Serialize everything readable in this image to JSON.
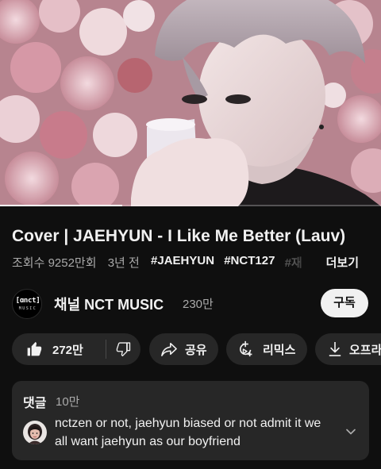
{
  "video": {
    "progress": 0.32
  },
  "title": "Cover | JAEHYUN - I Like Me Better (Lauv)",
  "meta": {
    "views": "조회수 9252만회",
    "age": "3년 전",
    "hashtags": [
      "#JAEHYUN",
      "#NCT127",
      "#재"
    ],
    "more_label": "더보기"
  },
  "channel": {
    "logo_text": "[ɑnct]",
    "logo_subtext": "MUSIC",
    "name": "채널 NCT MUSIC",
    "subscribers": "230만",
    "subscribe_label": "구독"
  },
  "actions": {
    "likes": "272만",
    "share_label": "공유",
    "remix_label": "리믹스",
    "offline_label": "오프라"
  },
  "comments": {
    "title": "댓글",
    "count": "10만",
    "top_comment": "nctzen or not, jaehyun biased or not admit it we all want jaehyun as our boyfriend"
  },
  "colors": {
    "background": "#0f0f0f",
    "pill": "#272727",
    "text": "#f1f1f1",
    "muted": "#aaaaaa",
    "subscribe_bg": "#f1f1f1"
  },
  "icons": [
    "thumbs-up-icon",
    "thumbs-down-icon",
    "share-icon",
    "remix-icon",
    "download-icon",
    "chevron-down-icon"
  ]
}
